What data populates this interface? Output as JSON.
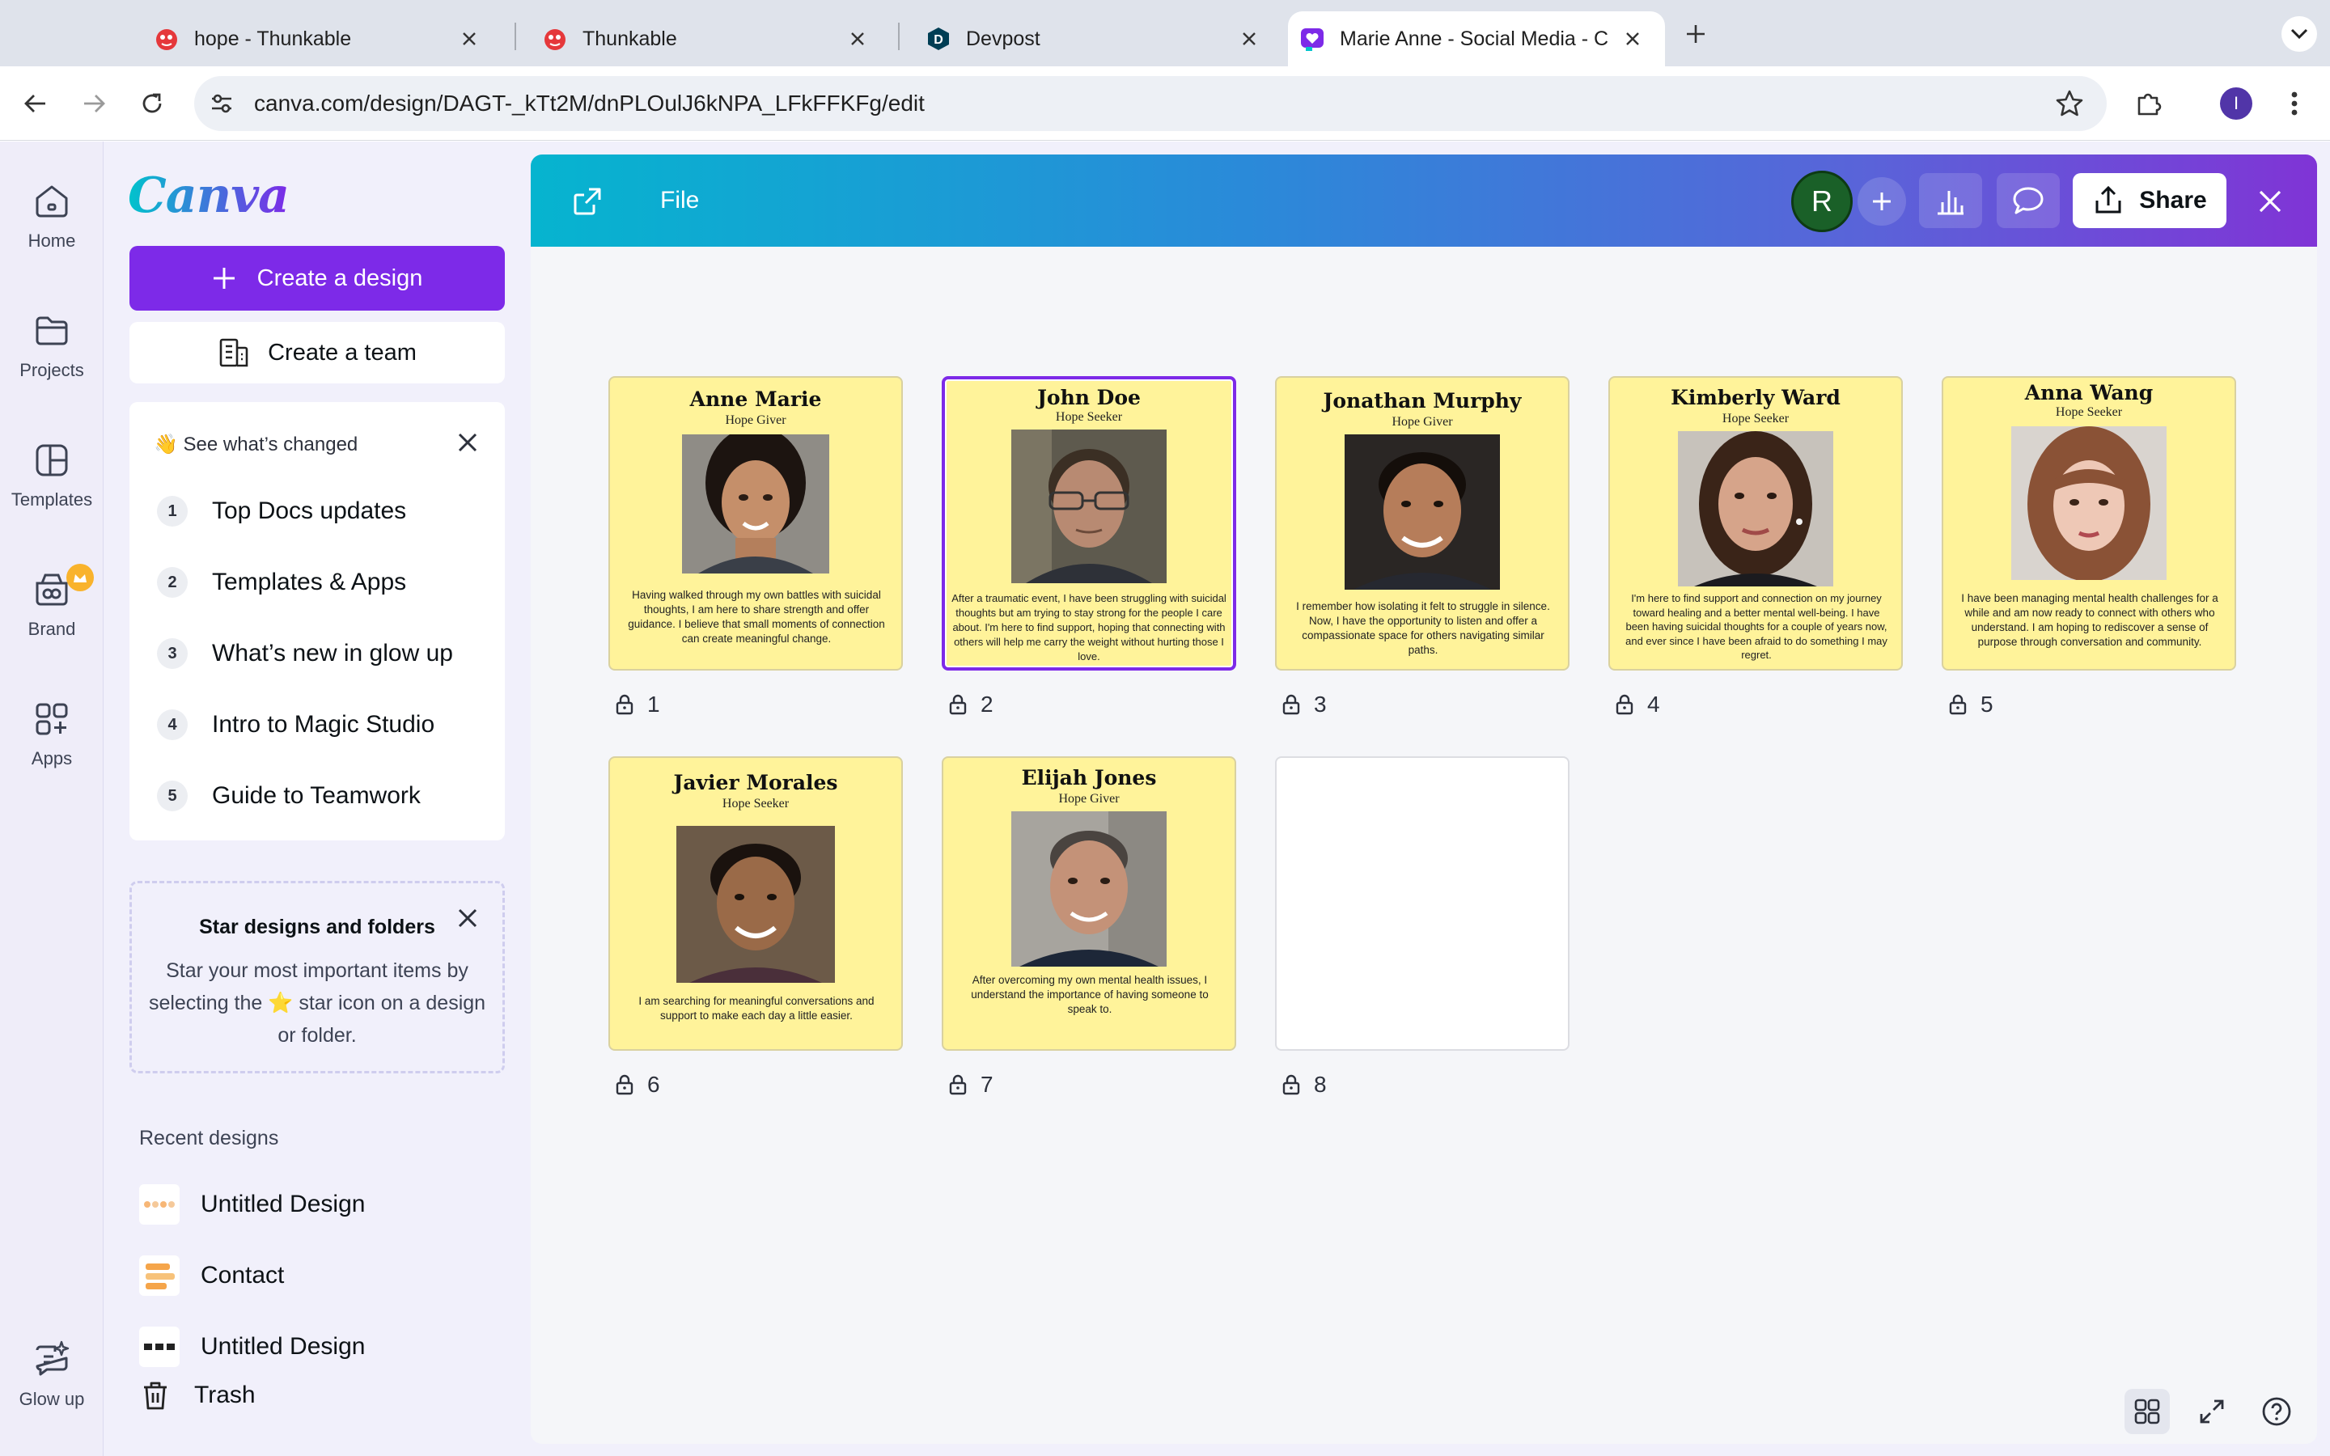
{
  "browser": {
    "tabs": [
      {
        "title": "hope - Thunkable",
        "favicon": "thunkable-icon"
      },
      {
        "title": "Thunkable",
        "favicon": "thunkable-icon"
      },
      {
        "title": "Devpost",
        "favicon": "devpost-icon"
      },
      {
        "title": "Marie Anne - Social Media - C",
        "favicon": "canva-heart-icon",
        "active": true
      }
    ],
    "url": "canva.com/design/DAGT-_kTt2M/dnPLOulJ6kNPA_LFkFFKFg/edit",
    "profile_initial": "I"
  },
  "rail": {
    "items": [
      {
        "label": "Home",
        "icon": "home-icon"
      },
      {
        "label": "Projects",
        "icon": "folder-icon"
      },
      {
        "label": "Templates",
        "icon": "templates-icon"
      },
      {
        "label": "Brand",
        "icon": "brand-icon"
      },
      {
        "label": "Apps",
        "icon": "apps-icon"
      }
    ],
    "glow_label": "Glow up"
  },
  "panel": {
    "logo": "Canva",
    "create_design": "Create a design",
    "create_team": "Create a team",
    "changes": {
      "heading": "👋 See what’s changed",
      "items": [
        {
          "num": "1",
          "label": "Top Docs updates"
        },
        {
          "num": "2",
          "label": "Templates & Apps"
        },
        {
          "num": "3",
          "label": "What’s new in glow up"
        },
        {
          "num": "4",
          "label": "Intro to Magic Studio"
        },
        {
          "num": "5",
          "label": "Guide to Teamwork"
        }
      ]
    },
    "stars": {
      "heading": "Star designs and folders",
      "body_before": "Star your most important items by selecting the ",
      "star_glyph": "⭐",
      "body_after": " star icon on a design or folder."
    },
    "recent_heading": "Recent designs",
    "recent": [
      {
        "label": "Untitled Design"
      },
      {
        "label": "Contact"
      },
      {
        "label": "Untitled Design"
      }
    ],
    "trash": "Trash"
  },
  "editor": {
    "file_label": "File",
    "avatar_initial": "R",
    "share_label": "Share",
    "accent": "#7d2ae8",
    "card_bg": "#fff39a",
    "pages": [
      {
        "num": "1",
        "name": "Anne Marie",
        "role": "Hope Giver",
        "body": "Having walked through my own battles with suicidal thoughts, I am here to share strength and offer guidance. I believe that small moments of connection can create meaningful change."
      },
      {
        "num": "2",
        "name": "John Doe",
        "role": "Hope Seeker",
        "body": "After a traumatic event, I have been struggling with suicidal thoughts but am trying to stay strong for the people I care about. I'm here to find support, hoping that connecting with others will help me carry the weight without hurting those I love.",
        "selected": true
      },
      {
        "num": "3",
        "name": "Jonathan Murphy",
        "role": "Hope Giver",
        "body": "I remember how isolating it felt to struggle in silence. Now, I have the opportunity to listen and offer a compassionate space for others navigating similar paths."
      },
      {
        "num": "4",
        "name": "Kimberly Ward",
        "role": "Hope Seeker",
        "body": "I'm here to find support and connection on my journey toward healing and a better mental well-being. I have been having suicidal thoughts for a couple of years now, and ever since I have been afraid to do something I may regret."
      },
      {
        "num": "5",
        "name": "Anna Wang",
        "role": "Hope Seeker",
        "body": "I have been managing mental health challenges for a while and am now ready to connect with others who understand. I am hoping to rediscover a sense of purpose through conversation and community."
      },
      {
        "num": "6",
        "name": "Javier Morales",
        "role": "Hope Seeker",
        "body": "I am searching for meaningful conversations and support to make each day a little easier."
      },
      {
        "num": "7",
        "name": "Elijah Jones",
        "role": "Hope Giver",
        "body": "After overcoming my own mental health issues, I understand the importance of having someone to speak to."
      },
      {
        "num": "8",
        "blank": true
      }
    ]
  }
}
